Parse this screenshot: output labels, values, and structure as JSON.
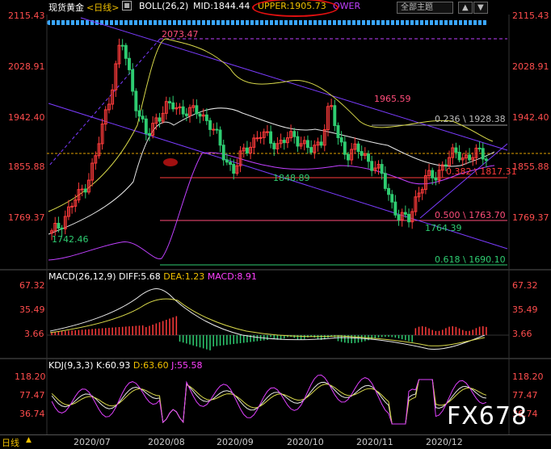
{
  "header": {
    "symbol": "现货黄金",
    "period_link": "<日线>",
    "boll_label": "BOLL(26,2)",
    "mid": "MID:1844.44",
    "upper": "UPPER:1905.73",
    "lower_partial": "OWER",
    "theme_select": "全部主题",
    "arrow_up": "▲",
    "arrow_down": "▼"
  },
  "colors": {
    "bg": "#000000",
    "bull": "#ff3b3b",
    "bear": "#2ecc71",
    "channel": "#7b3cff",
    "boll_mid": "#e8e8e8",
    "boll_upper": "#d8d84a",
    "boll_lower": "#c040ff",
    "fib": "#ff4d7a",
    "price_line": "#e0a000",
    "upper_circle": "#e01010",
    "dots": "#3aa6ff"
  },
  "main_axis": {
    "ticks": [
      "2115.43",
      "2028.91",
      "1942.40",
      "1855.88",
      "1769.37"
    ],
    "range": [
      1690,
      2115.43
    ]
  },
  "annotations": {
    "high": "2073.47",
    "nov_high": "1965.59",
    "sep_low": "1848.89",
    "jul_low": "1742.46",
    "nov_low": "1764.39",
    "fib_0236": "0.236 \\ 1928.38",
    "fib_0382": "0.382 \\ 1817.31",
    "fib_0500": "0.500 \\ 1763.70",
    "fib_0618": "0.618 \\ 1690.10"
  },
  "macd": {
    "label": "MACD(26,12,9)",
    "diff": "DIFF:5.68",
    "dea": "DEA:1.23",
    "macd": "MACD:8.91",
    "ticks": [
      "67.32",
      "35.49",
      "3.66"
    ]
  },
  "kdj": {
    "label": "KDJ(9,3,3)",
    "k": "K:60.93",
    "d": "D:63.60",
    "j": "J:55.58",
    "ticks": [
      "118.20",
      "77.47",
      "36.74"
    ]
  },
  "x_axis": {
    "corner": "日线",
    "dates": [
      "2020/07",
      "2020/08",
      "2020/09",
      "2020/10",
      "2020/11",
      "2020/12"
    ]
  },
  "watermark": "FX678",
  "chart_data": {
    "type": "candlestick",
    "instrument": "现货黄金",
    "period": "日线",
    "x": [
      "2020/07",
      "2020/08",
      "2020/09",
      "2020/10",
      "2020/11",
      "2020/12"
    ],
    "ylim": [
      1690,
      2115.43
    ],
    "close_path": [
      1742,
      1760,
      1785,
      1805,
      1830,
      1870,
      1935,
      2000,
      2073,
      2010,
      1945,
      1905,
      1940,
      1955,
      1960,
      1955,
      1948,
      1950,
      1935,
      1905,
      1870,
      1850,
      1880,
      1900,
      1910,
      1905,
      1895,
      1902,
      1910,
      1895,
      1880,
      1905,
      1965,
      1900,
      1880,
      1885,
      1875,
      1860,
      1840,
      1800,
      1770,
      1764,
      1810,
      1835,
      1840,
      1860,
      1875,
      1880,
      1870,
      1880,
      1878
    ],
    "series": [
      {
        "name": "BOLL(26,2) MID",
        "last": 1844.44
      },
      {
        "name": "BOLL(26,2) UPPER",
        "last": 1905.73
      },
      {
        "name": "MACD DIFF",
        "last": 5.68
      },
      {
        "name": "MACD DEA",
        "last": 1.23
      },
      {
        "name": "MACD",
        "last": 8.91
      },
      {
        "name": "KDJ K",
        "last": 60.93
      },
      {
        "name": "KDJ D",
        "last": 63.6
      },
      {
        "name": "KDJ J",
        "last": 55.58
      }
    ],
    "fibonacci": [
      {
        "level": 0.236,
        "price": 1928.38
      },
      {
        "level": 0.382,
        "price": 1817.31
      },
      {
        "level": 0.5,
        "price": 1763.7
      },
      {
        "level": 0.618,
        "price": 1690.1
      }
    ],
    "macd_range": [
      -30,
      67.32
    ],
    "kdj_range": [
      -5,
      118.2
    ]
  }
}
